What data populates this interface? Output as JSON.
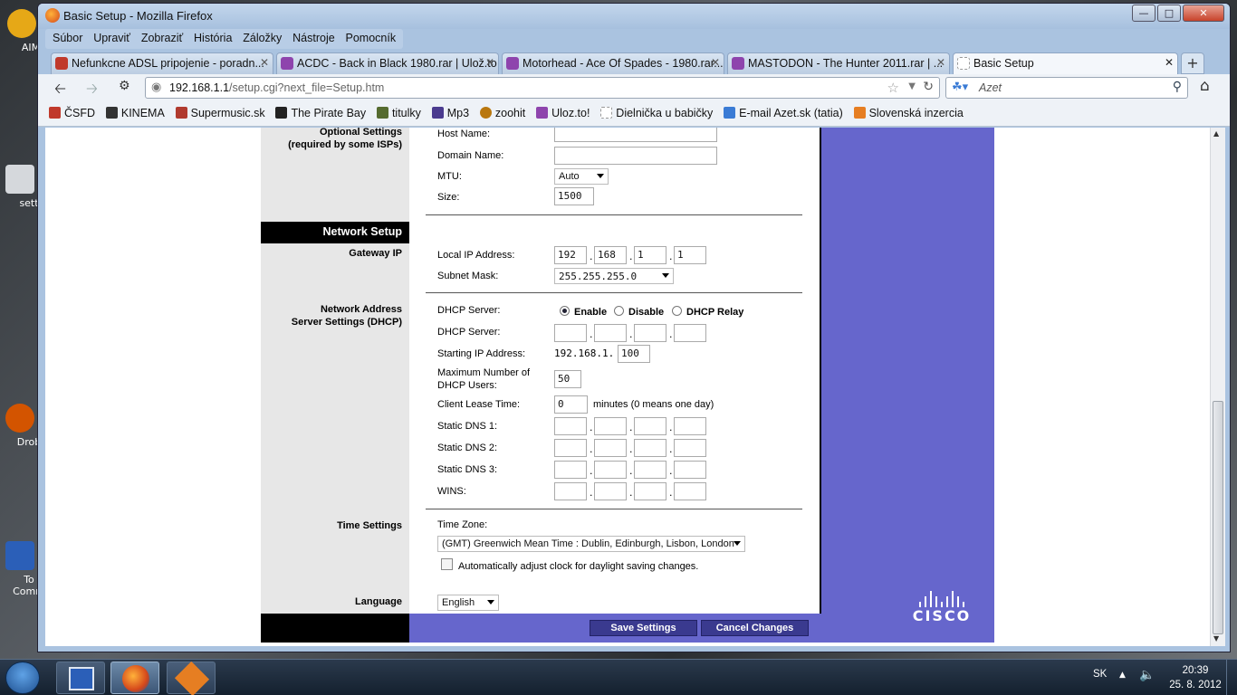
{
  "window": {
    "title": "Basic Setup - Mozilla Firefox"
  },
  "menu": [
    "Súbor",
    "Upraviť",
    "Zobraziť",
    "História",
    "Záložky",
    "Nástroje",
    "Pomocník"
  ],
  "tabs": [
    {
      "label": "Nefunkcne ADSL pripojenie - poradn...",
      "color": "#c0392b"
    },
    {
      "label": "ACDC - Back in Black 1980.rar | Ulož.to",
      "color": "#8e44ad"
    },
    {
      "label": "Motorhead - Ace Of Spades - 1980.rar...",
      "color": "#8e44ad"
    },
    {
      "label": "MASTODON - The Hunter 2011.rar | ...",
      "color": "#8e44ad"
    },
    {
      "label": "Basic Setup",
      "color": "#ffffff"
    }
  ],
  "address": {
    "host": "192.168.1.1",
    "path": "/setup.cgi?next_file=Setup.htm"
  },
  "search": {
    "placeholder": "Azet"
  },
  "bookmarks": [
    {
      "label": "ČSFD",
      "color": "#c0392b"
    },
    {
      "label": "KINEMA",
      "color": "#333333"
    },
    {
      "label": "Supermusic.sk",
      "color": "#b03a2e"
    },
    {
      "label": "The Pirate Bay",
      "color": "#222222"
    },
    {
      "label": "titulky",
      "color": "#556b2f"
    },
    {
      "label": "Mp3",
      "color": "#4b3b8f"
    },
    {
      "label": "zoohit",
      "color": "#b9770e"
    },
    {
      "label": "Uloz.to!",
      "color": "#8e44ad"
    },
    {
      "label": "Dielnička u babičky",
      "color": "#dddddd"
    },
    {
      "label": "E-mail Azet.sk (tatia)",
      "color": "#3a7bd5"
    },
    {
      "label": "Slovenská inzercia",
      "color": "#e67e22"
    }
  ],
  "router": {
    "optional_settings_label": "Optional Settings\n(required by some ISPs)",
    "host_name_label": "Host Name:",
    "domain_name_label": "Domain Name:",
    "mtu_label": "MTU:",
    "mtu_value": "Auto",
    "size_label": "Size:",
    "size_value": "1500",
    "network_setup": "Network Setup",
    "gateway_ip": "Gateway IP",
    "local_ip_label": "Local IP Address:",
    "local_ip": [
      "192",
      "168",
      "1",
      "1"
    ],
    "subnet_label": "Subnet Mask:",
    "subnet_value": "255.255.255.0",
    "dhcp_section": "Network Address\nServer Settings (DHCP)",
    "dhcp_server_label": "DHCP Server:",
    "radio_enable": "Enable",
    "radio_disable": "Disable",
    "radio_relay": "DHCP Relay",
    "dhcp_server2_label": "DHCP Server:",
    "start_ip_label": "Starting IP Address:",
    "start_ip_prefix": "192.168.1.",
    "start_ip_last": "100",
    "max_users_label": "Maximum Number of\nDHCP Users:",
    "max_users": "50",
    "lease_label": "Client Lease Time:",
    "lease_value": "0",
    "lease_suffix": "minutes (0 means one day)",
    "dns1_label": "Static DNS 1:",
    "dns2_label": "Static DNS 2:",
    "dns3_label": "Static DNS 3:",
    "wins_label": "WINS:",
    "time_settings": "Time Settings",
    "time_zone_label": "Time Zone:",
    "time_zone_value": "(GMT) Greenwich Mean Time : Dublin, Edinburgh, Lisbon, London",
    "dst_label": "Automatically adjust clock for daylight saving changes.",
    "language_section": "Language",
    "language_value": "English",
    "save_button": "Save Settings",
    "cancel_button": "Cancel Changes",
    "brand": "CISCO"
  },
  "taskbar": {
    "lang": "SK",
    "time": "20:39",
    "date": "25. 8. 2012"
  },
  "desktop_icons": [
    "AIM",
    "sett",
    "Drob",
    "To\nComm"
  ]
}
